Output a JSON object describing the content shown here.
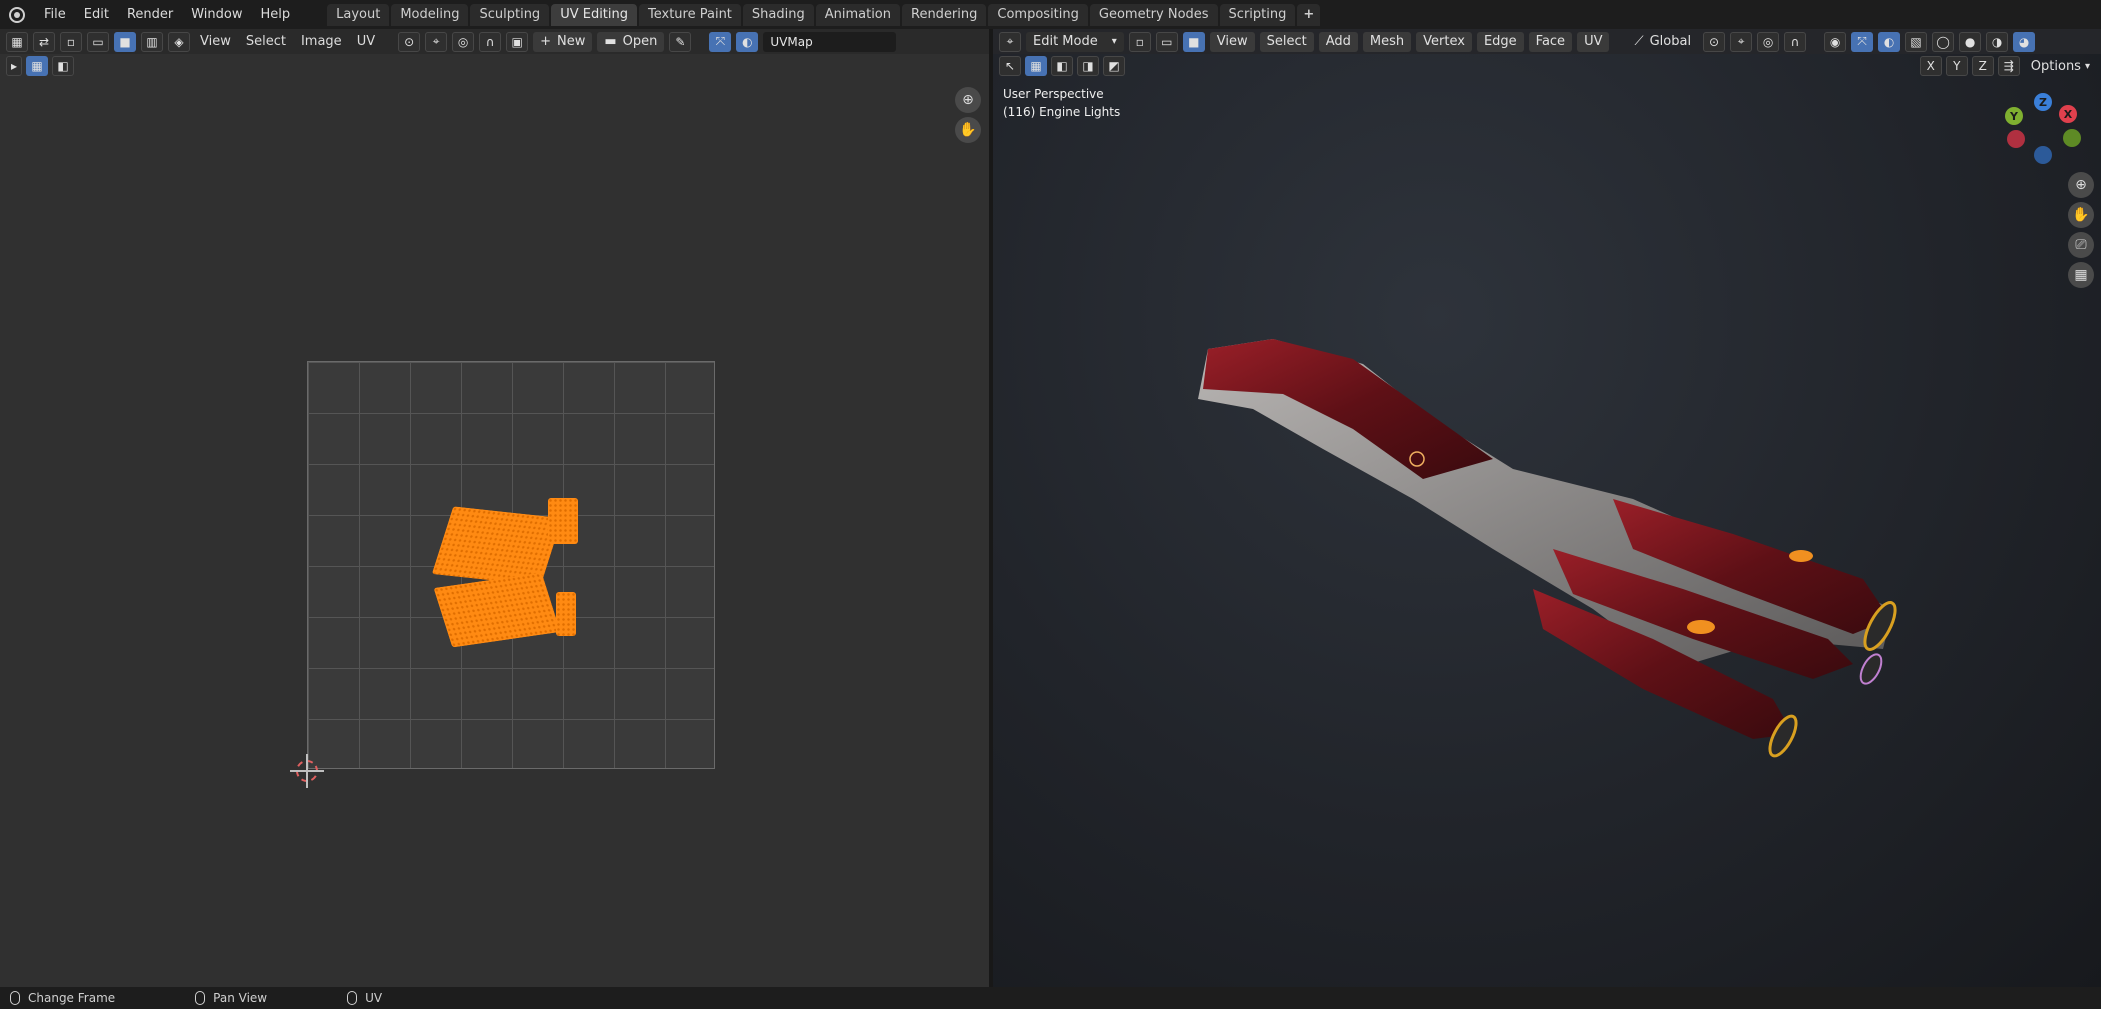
{
  "topbar": {
    "menus": [
      "File",
      "Edit",
      "Render",
      "Window",
      "Help"
    ],
    "tabs": [
      "Layout",
      "Modeling",
      "Sculpting",
      "UV Editing",
      "Texture Paint",
      "Shading",
      "Animation",
      "Rendering",
      "Compositing",
      "Geometry Nodes",
      "Scripting"
    ],
    "active_tab": "UV Editing",
    "add_tab": "+"
  },
  "uv_editor": {
    "menus": [
      "View",
      "Select",
      "Image",
      "UV"
    ],
    "new_label": "New",
    "open_label": "Open",
    "uvmap_name": "UVMap",
    "new_icon": "+"
  },
  "viewport": {
    "mode": "Edit Mode",
    "menus": [
      "View",
      "Select",
      "Add",
      "Mesh",
      "Vertex",
      "Edge",
      "Face",
      "UV"
    ],
    "orientation": "Global",
    "options_label": "Options",
    "axis_labels": [
      "X",
      "Y",
      "Z"
    ],
    "overlay_line1": "User Perspective",
    "overlay_line2": "(116) Engine Lights",
    "gizmo": {
      "x": "X",
      "y": "Y",
      "z": "Z"
    }
  },
  "statusbar": {
    "items": [
      "Change Frame",
      "Pan View",
      "UV"
    ]
  },
  "colors": {
    "accent": "#4772b3",
    "uv_selection": "#ff8a12",
    "ship_red": "#8a1820",
    "gizmo_x": "#e0404d",
    "gizmo_y": "#7fb030",
    "gizmo_z": "#3a7fd9"
  }
}
